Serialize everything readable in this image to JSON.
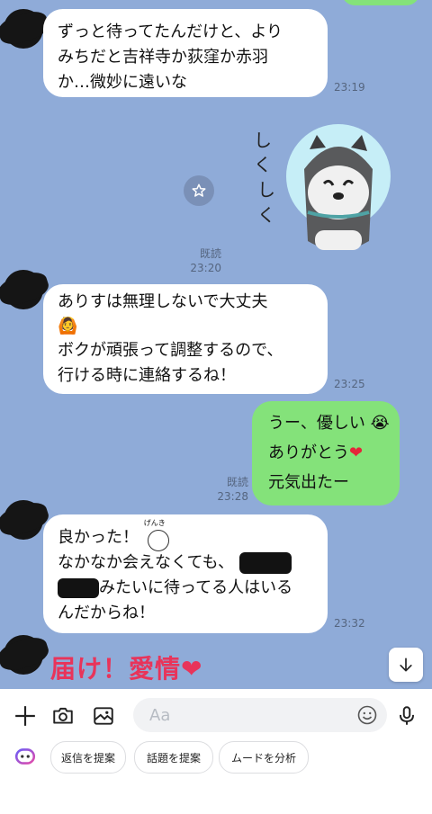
{
  "messages": [
    {
      "lines": [
        "ずっと待ってたんだけと、より",
        "みちだと吉祥寺か荻窪か赤羽",
        "か…微妙に遠いな"
      ],
      "time": "23:19"
    },
    {
      "read": "既読",
      "time": "23:20"
    },
    {
      "lines": [
        "ありすは無理しないで大丈夫",
        "ボクが頑張って調整するので、",
        "行ける時に連絡するね！"
      ],
      "time": "23:25"
    },
    {
      "lines": [
        "うー、優しい",
        "ありがとう",
        "元気出たー"
      ],
      "read": "既読",
      "time": "23:28"
    },
    {
      "lines": [
        "良かった！",
        "なかなか会えなくても、",
        "みたいに待ってる人はいる",
        "んだからね！"
      ],
      "time": "23:32"
    }
  ],
  "sticker": {
    "small_text": "げんき",
    "bottom_text": "届け！愛情"
  },
  "composer": {
    "placeholder": "Aa"
  },
  "suggestions": [
    "返信を提案",
    "話題を提案",
    "ムードを分析"
  ],
  "colors": {
    "chat_bg": "#8fabd8",
    "outgoing": "#84e27a",
    "incoming": "#ffffff"
  }
}
